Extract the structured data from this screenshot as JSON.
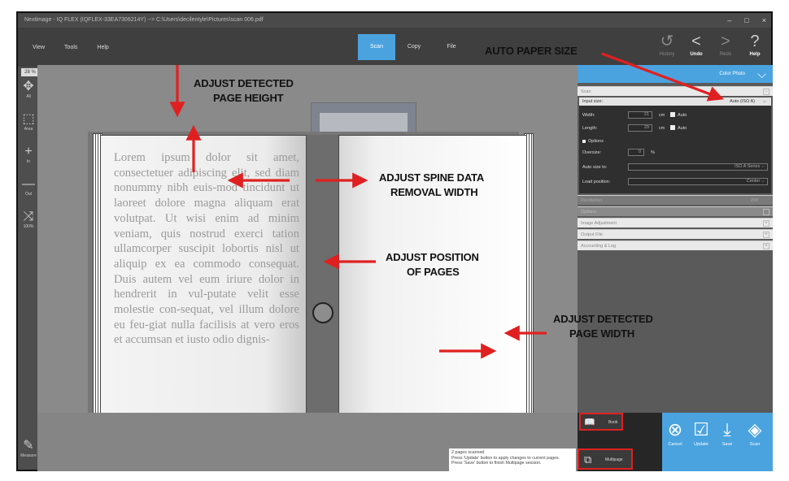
{
  "window": {
    "title": "Nextimage - IQ FLEX (IQFLEX-33EA7306214Y) --> C:\\Users\\decilentyle\\Pictures\\scan 006.pdf",
    "controls": [
      "–",
      "□",
      "×"
    ]
  },
  "menu": {
    "items": [
      "View",
      "Tools",
      "Help"
    ]
  },
  "mode_tabs": [
    "Scan",
    "Copy",
    "File"
  ],
  "history": {
    "history": "History",
    "undo": "Undo",
    "redo": "Redo",
    "help": "Help"
  },
  "toolbar": {
    "zoom": "28 %",
    "tools": [
      "All",
      "Area",
      "In",
      "Out",
      "100%",
      "Measure"
    ]
  },
  "book_text": "Lorem ipsum dolor sit amet, consectetuer adipiscing elit, sed diam nonummy nibh euis-mod tincidunt ut laoreet dolore magna aliquam erat volutpat. Ut wisi enim ad minim veniam, quis nostrud exerci tation ullamcorper suscipit lobortis nisl ut aliquip ex ea commodo consequat. Duis autem vel eum iriure dolor in hendrerit in vul-putate velit esse molestie con-sequat, vel illum dolore eu feu-giat nulla facilisis at vero eros et accumsan et iusto odio dignis-",
  "annotations": {
    "auto_paper_size": "AUTO PAPER SIZE",
    "page_height_1": "ADJUST DETECTED",
    "page_height_2": "PAGE HEIGHT",
    "spine_1": "ADJUST SPINE DATA",
    "spine_2": "REMOVAL WIDTH",
    "position_1": "ADJUST POSITION",
    "position_2": "OF PAGES",
    "page_width_1": "ADJUST DETECTED",
    "page_width_2": "PAGE WIDTH"
  },
  "panel": {
    "profile": "Color Photo",
    "scan_section": "Scan",
    "input_size_label": "Input size:",
    "input_size_value": "Auto (ISO A)",
    "width_label": "Width:",
    "width_value": "21",
    "length_label": "Length:",
    "length_value": "29",
    "unit": "cm",
    "auto_label": "Auto",
    "options_label": "Options",
    "oversize_label": "Oversize:",
    "oversize_value": "0",
    "percent": "%",
    "auto_size_to_label": "Auto size to:",
    "auto_size_to_value": "ISO A Series",
    "load_position_label": "Load position:",
    "load_position_value": "Center",
    "resolution_label": "Resolution:",
    "resolution_value": "200",
    "sections": [
      "Options",
      "Image Adjustment",
      "Output File",
      "Accounting & Log"
    ]
  },
  "bottom": {
    "book": "Book",
    "multipage": "Multipage",
    "status_lines": [
      "2 pages scanned",
      "Press 'Update' button to apply changes to current pages.",
      "Press 'Save' button to finish Multipage session."
    ],
    "buttons": [
      "Cancel",
      "Update",
      "Save",
      "Scan"
    ]
  },
  "colors": {
    "accent": "#4aa3df",
    "annotation_red": "#e02020"
  }
}
